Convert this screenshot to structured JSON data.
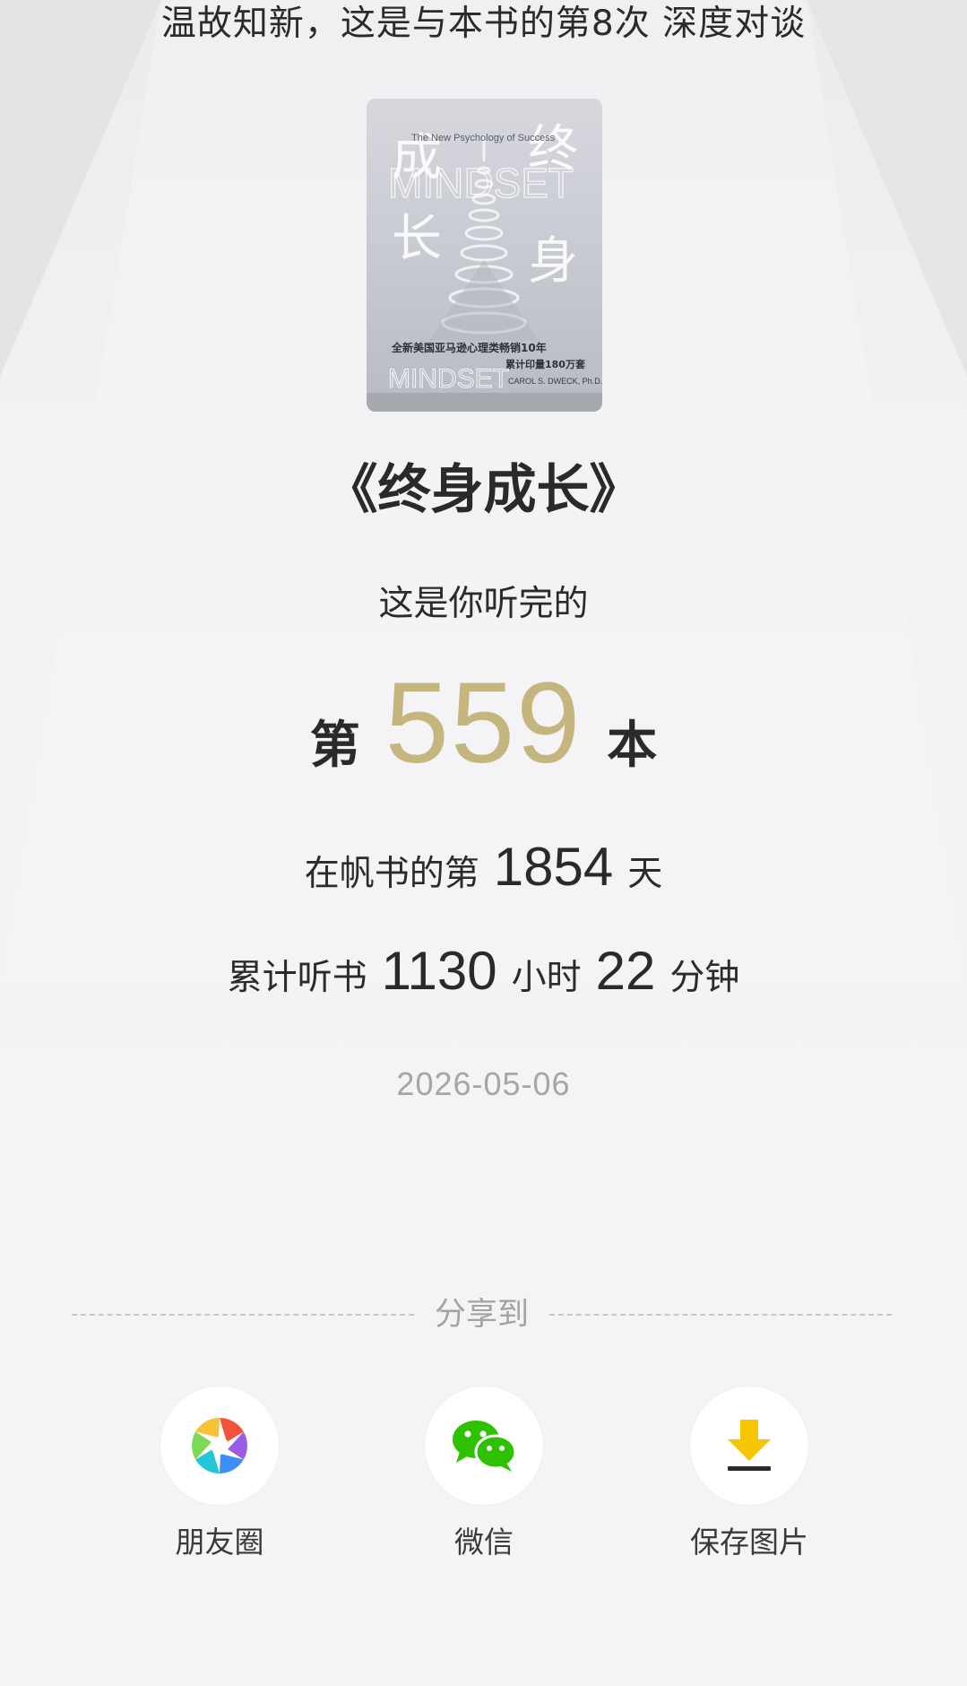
{
  "header": {
    "tagline": "温故知新，这是与本书的第8次 深度对谈"
  },
  "book": {
    "title": "《终身成长》",
    "cover_title_cn_a": "成",
    "cover_title_cn_b": "终",
    "cover_title_cn_c": "长",
    "cover_title_cn_d": "身",
    "cover_en_title": "MINDSET",
    "cover_en_subtitle": "The New Psychology of Success",
    "cover_blurb_1": "全新美国亚马逊心理类畅销10年",
    "cover_blurb_2": "累计印量180万套",
    "cover_author": "CAROL S. DWECK, Ph.D."
  },
  "stats": {
    "intro": "这是你听完的",
    "rank_prefix": "第",
    "rank_number": "559",
    "rank_suffix": "本",
    "days_prefix": "在帆书的第",
    "days_number": "1854",
    "days_suffix": "天",
    "hours_prefix": "累计听书",
    "hours_number": "1130",
    "hours_unit": "小时",
    "minutes_number": "22",
    "minutes_unit": "分钟",
    "date": "2026-05-06"
  },
  "share": {
    "label": "分享到",
    "buttons": [
      {
        "label": "朋友圈",
        "icon": "moments-icon"
      },
      {
        "label": "微信",
        "icon": "wechat-icon"
      },
      {
        "label": "保存图片",
        "icon": "download-icon"
      }
    ]
  },
  "colors": {
    "accent_gold": "#c5b57e",
    "wechat_green": "#2dc100",
    "download_yellow": "#f6c700"
  }
}
